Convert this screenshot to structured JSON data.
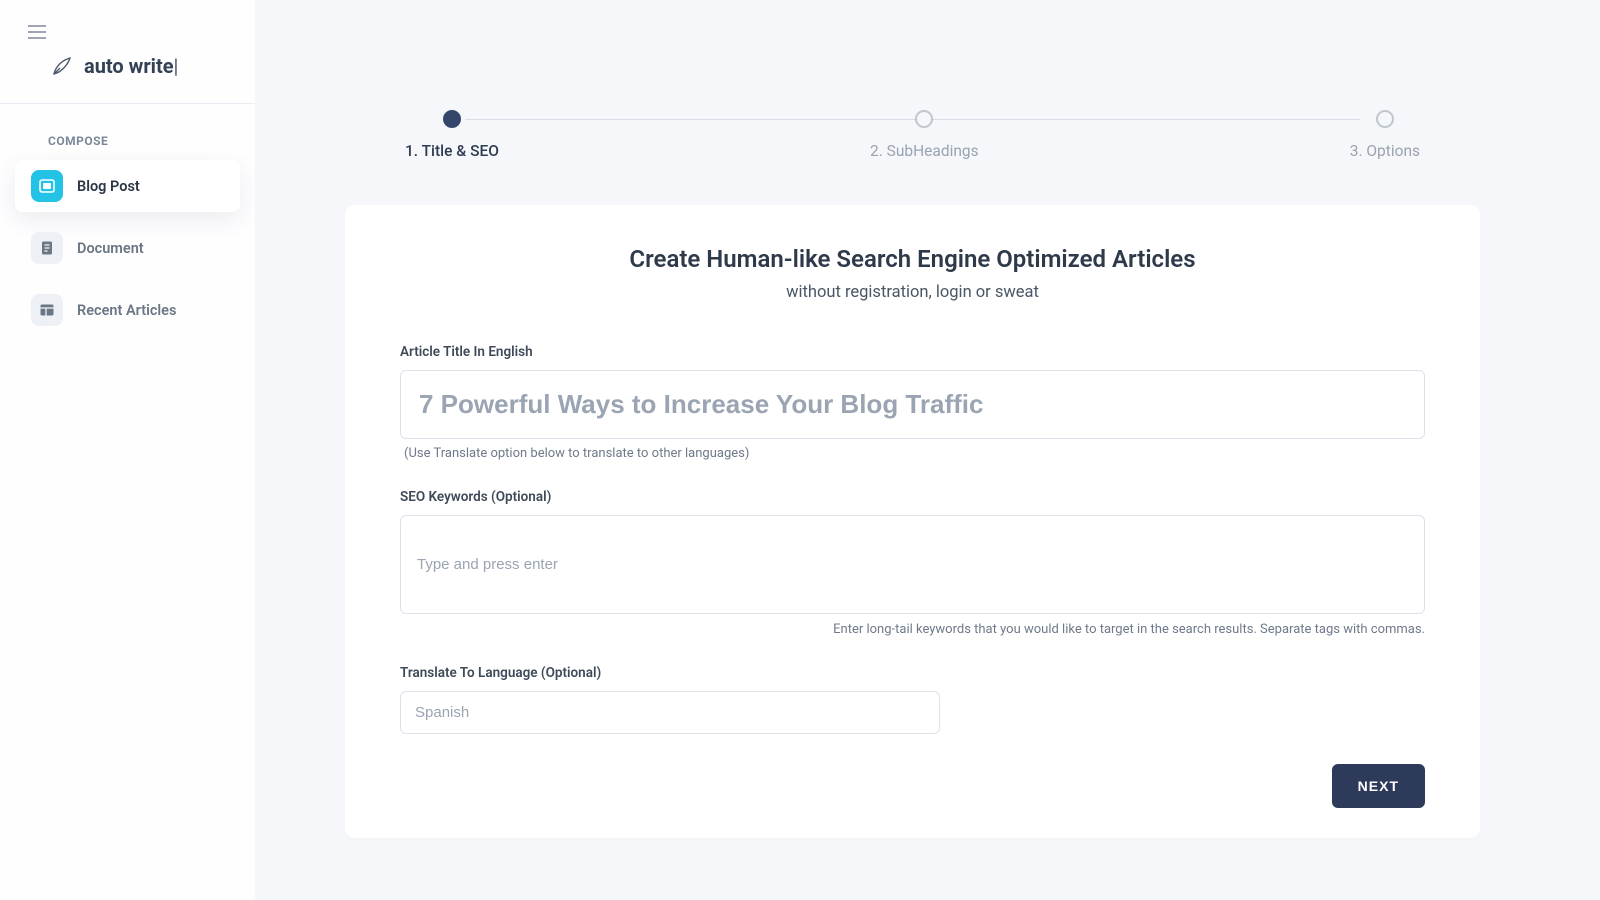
{
  "brand": {
    "name": "auto write",
    "cursor": "|"
  },
  "sidebar": {
    "section": "COMPOSE",
    "items": [
      {
        "label": "Blog Post"
      },
      {
        "label": "Document"
      },
      {
        "label": "Recent Articles"
      }
    ]
  },
  "stepper": {
    "steps": [
      {
        "label": "1. Title & SEO"
      },
      {
        "label": "2. SubHeadings"
      },
      {
        "label": "3. Options"
      }
    ]
  },
  "card": {
    "title": "Create Human-like Search Engine Optimized Articles",
    "subtitle": "without registration, login or sweat",
    "title_field_label": "Article Title In English",
    "title_placeholder": "7 Powerful Ways to Increase Your Blog Traffic",
    "title_hint": "(Use Translate option below to translate to other languages)",
    "seo_label": "SEO Keywords (Optional)",
    "seo_placeholder": "Type and press enter",
    "seo_hint": "Enter long-tail keywords that you would like to target in the search results. Separate tags with commas.",
    "translate_label": "Translate To Language (Optional)",
    "translate_placeholder": "Spanish",
    "next_button": "NEXT"
  }
}
